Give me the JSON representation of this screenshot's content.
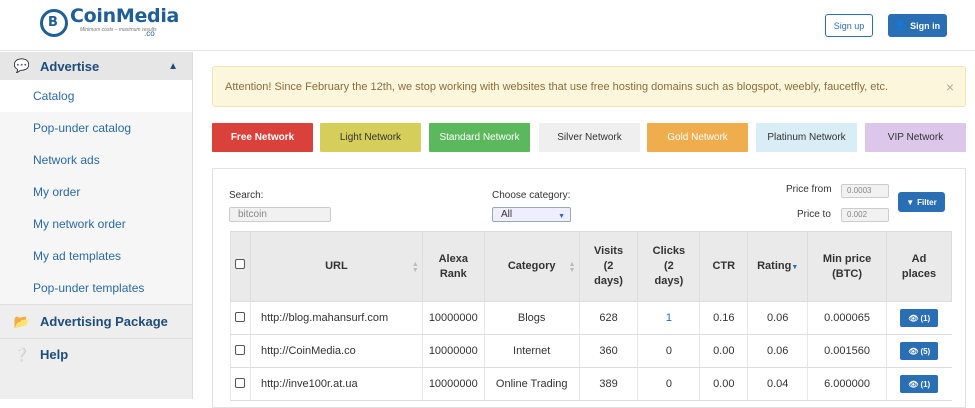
{
  "header": {
    "logo_name": "CoinMedia",
    "logo_tld": ".co",
    "logo_tagline": "Minimum costs – maximum results",
    "signup_label": "Sign up",
    "signin_label": "Sign in"
  },
  "sidebar": {
    "advertise_label": "Advertise",
    "items": [
      {
        "label": "Catalog"
      },
      {
        "label": "Pop-under catalog"
      },
      {
        "label": "Network ads"
      },
      {
        "label": "My order"
      },
      {
        "label": "My network order"
      },
      {
        "label": "My ad templates"
      },
      {
        "label": "Pop-under templates"
      }
    ],
    "package_label": "Advertising Package",
    "help_label": "Help"
  },
  "alert": {
    "text": "Attention! Since February the 12th, we stop working with websites that use free hosting domains such as blogspot, weebly, faucetfly, etc.",
    "close": "×"
  },
  "networks": {
    "free": "Free Network",
    "light": "Light Network",
    "standard": "Standard Network",
    "silver": "Silver Network",
    "gold": "Gold Network",
    "platinum": "Platinum Network",
    "vip": "VIP Network"
  },
  "filters": {
    "search_label": "Search:",
    "search_value": "bitcoin",
    "category_label": "Choose category:",
    "category_value": "All",
    "price_from_label": "Price from",
    "price_from_value": "0.0003",
    "price_to_label": "Price to",
    "price_to_value": "0.002",
    "filter_label": "Filter"
  },
  "table": {
    "headers": {
      "url": "URL",
      "alexa1": "Alexa",
      "alexa2": "Rank",
      "category": "Category",
      "visits1": "Visits",
      "visits2": "(2",
      "visits3": "days)",
      "clicks1": "Clicks",
      "clicks2": "(2",
      "clicks3": "days)",
      "ctr": "CTR",
      "rating": "Rating",
      "minprice1": "Min price",
      "minprice2": "(BTC)",
      "adplaces1": "Ad",
      "adplaces2": "places"
    },
    "rows": [
      {
        "url": "http://blog.mahansurf.com",
        "alexa": "10000000",
        "category": "Blogs",
        "visits": "628",
        "clicks": "1",
        "ctr": "0.16",
        "rating": "0.06",
        "min_price": "0.000065",
        "places": "(1)"
      },
      {
        "url": "http://CoinMedia.co",
        "alexa": "10000000",
        "category": "Internet",
        "visits": "360",
        "clicks": "0",
        "ctr": "0.00",
        "rating": "0.06",
        "min_price": "0.001560",
        "places": "(5)"
      },
      {
        "url": "http://inve100r.at.ua",
        "alexa": "10000000",
        "category": "Online Trading",
        "visits": "389",
        "clicks": "0",
        "ctr": "0.00",
        "rating": "0.04",
        "min_price": "6.000000",
        "places": "(1)"
      }
    ]
  },
  "colors": {
    "brand": "#1f5e97",
    "primary": "#2a6fb4",
    "free": "#d9413a",
    "light": "#d6ce5a",
    "standard": "#5cb85c",
    "silver": "#efefef",
    "gold": "#f0ad4e",
    "platinum": "#d9edf7",
    "vip": "#dcc6ea"
  }
}
